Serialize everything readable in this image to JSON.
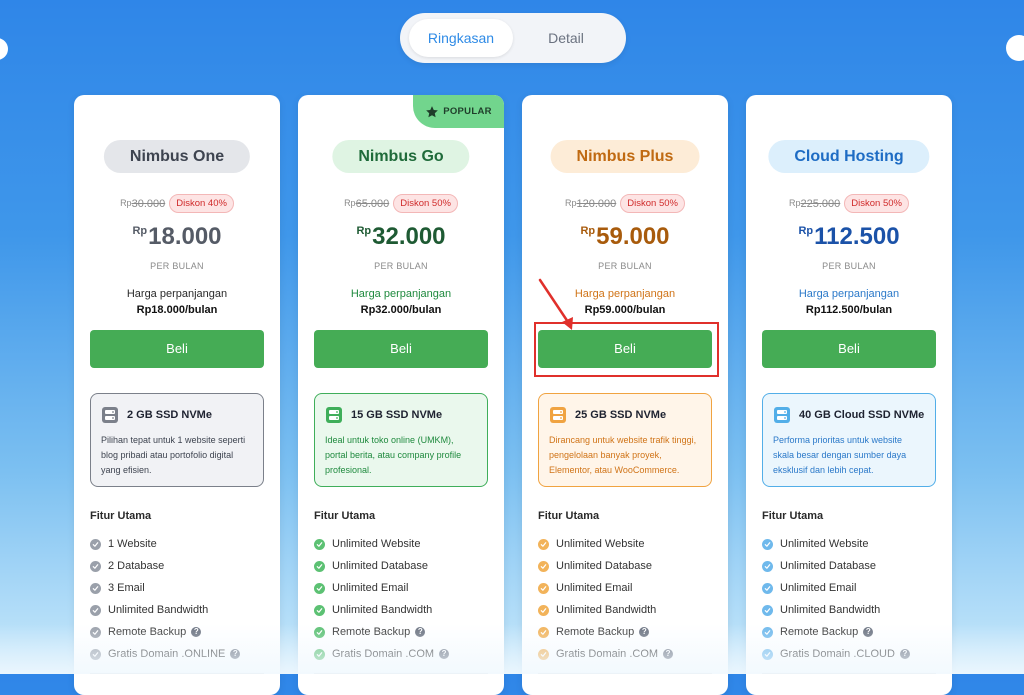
{
  "toggle": {
    "active_label": "Ringkasan",
    "inactive_label": "Detail"
  },
  "colors": {
    "buy_button": "#45ac55",
    "highlight": "#e0302b",
    "discount_text": "#d02b2b"
  },
  "plans": [
    {
      "name": "Nimbus One",
      "old_currency": "Rp",
      "old_price": "30.000",
      "discount": "Diskon 40%",
      "currency": "Rp",
      "price": "18.000",
      "per": "PER BULAN",
      "renew_label": "Harga perpanjangan",
      "renew_value": "Rp18.000/bulan",
      "buy_label": "Beli",
      "storage_icon": "server-icon",
      "storage": "2 GB SSD NVMe",
      "description": "Pilihan tepat untuk 1 website seperti blog pribadi atau portofolio digital yang efisien.",
      "features_title": "Fitur Utama",
      "features": [
        "1 Website",
        "2 Database",
        "3 Email",
        "Unlimited Bandwidth",
        "Remote Backup",
        "Gratis Domain .ONLINE"
      ],
      "accent": "#555b66",
      "name_bg": "#e4e6ea",
      "name_color": "#3e4450",
      "box_bg": "#f1f2f5",
      "box_border": "#7b808a",
      "box_text": "#3e4450",
      "check_bg": "#9aa0aa"
    },
    {
      "name": "Nimbus Go",
      "old_currency": "Rp",
      "old_price": "65.000",
      "discount": "Diskon 50%",
      "currency": "Rp",
      "price": "32.000",
      "per": "PER BULAN",
      "renew_label": "Harga perpanjangan",
      "renew_value": "Rp32.000/bulan",
      "buy_label": "Beli",
      "storage_icon": "server-icon",
      "storage": "15 GB SSD NVMe",
      "description": "Ideal untuk toko online (UMKM), portal berita, atau company profile profesional.",
      "features_title": "Fitur Utama",
      "features": [
        "Unlimited Website",
        "Unlimited Database",
        "Unlimited Email",
        "Unlimited Bandwidth",
        "Remote Backup",
        "Gratis Domain .COM"
      ],
      "badge": "POPULAR",
      "accent": "#1e5a33",
      "name_bg": "#dff4e3",
      "name_color": "#1f6b3a",
      "box_bg": "#eaf8ed",
      "box_border": "#3fae5a",
      "box_text": "#1f8a3e",
      "check_bg": "#5cc173"
    },
    {
      "name": "Nimbus Plus",
      "old_currency": "Rp",
      "old_price": "120.000",
      "discount": "Diskon 50%",
      "currency": "Rp",
      "price": "59.000",
      "per": "PER BULAN",
      "renew_label": "Harga perpanjangan",
      "renew_value": "Rp59.000/bulan",
      "buy_label": "Beli",
      "storage_icon": "server-icon",
      "storage": "25 GB SSD NVMe",
      "description": "Dirancang untuk website trafik tinggi, pengelolaan banyak proyek, Elementor, atau WooCommerce.",
      "features_title": "Fitur Utama",
      "features": [
        "Unlimited Website",
        "Unlimited Database",
        "Unlimited Email",
        "Unlimited Bandwidth",
        "Remote Backup",
        "Gratis Domain .COM"
      ],
      "accent": "#a85b0c",
      "name_bg": "#fdecd7",
      "name_color": "#c06a12",
      "box_bg": "#fff5e9",
      "box_border": "#f0a341",
      "box_text": "#d07418",
      "check_bg": "#f2b35a"
    },
    {
      "name": "Cloud Hosting",
      "old_currency": "Rp",
      "old_price": "225.000",
      "discount": "Diskon 50%",
      "currency": "Rp",
      "price": "112.500",
      "per": "PER BULAN",
      "renew_label": "Harga perpanjangan",
      "renew_value": "Rp112.500/bulan",
      "buy_label": "Beli",
      "storage_icon": "server-icon",
      "storage": "40 GB Cloud SSD NVMe",
      "description": "Performa prioritas untuk website skala besar dengan sumber daya eksklusif dan lebih cepat.",
      "features_title": "Fitur Utama",
      "features": [
        "Unlimited Website",
        "Unlimited Database",
        "Unlimited Email",
        "Unlimited Bandwidth",
        "Remote Backup",
        "Gratis Domain .CLOUD"
      ],
      "accent": "#1b52a8",
      "name_bg": "#dceffc",
      "name_color": "#1e6cc4",
      "box_bg": "#ebf6fd",
      "box_border": "#52aee8",
      "box_text": "#2b79c9",
      "check_bg": "#6fb9ec"
    }
  ],
  "help_icon_label": "?",
  "help_features": [
    "Remote Backup",
    "Gratis Domain .ONLINE",
    "Gratis Domain .COM",
    "Gratis Domain .CLOUD"
  ]
}
